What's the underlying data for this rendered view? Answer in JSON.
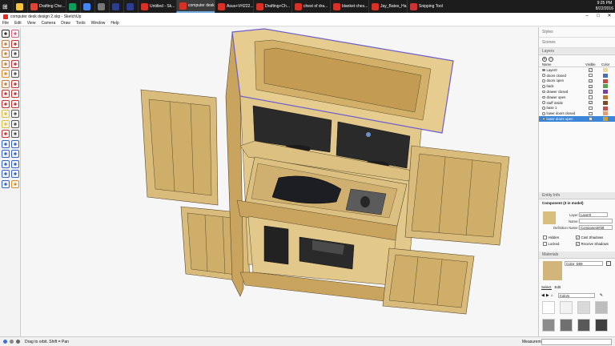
{
  "taskbar": {
    "items": [
      {
        "label": "",
        "icon": "folder-icon",
        "color": "#f4c542"
      },
      {
        "label": "Drafting Che...",
        "icon": "chrome-icon",
        "color": "#db4437"
      },
      {
        "label": "",
        "icon": "chrome-icon",
        "color": "#0f9d58"
      },
      {
        "label": "",
        "icon": "chrome-icon",
        "color": "#4285f4"
      },
      {
        "label": "",
        "icon": "calculator-icon",
        "color": "#777777"
      },
      {
        "label": "",
        "icon": "photoshop-icon",
        "color": "#2d3e8f"
      },
      {
        "label": "",
        "icon": "photoshop-icon",
        "color": "#2d3e8f"
      },
      {
        "label": "Untitled - Sk...",
        "icon": "sketchup-icon",
        "color": "#d93025"
      },
      {
        "label": "computer desk...",
        "icon": "sketchup-icon",
        "color": "#d93025",
        "active": true
      },
      {
        "label": "Asus+VH222...",
        "icon": "sketchup-icon",
        "color": "#d93025"
      },
      {
        "label": "Drafting+Ch...",
        "icon": "sketchup-icon",
        "color": "#d93025"
      },
      {
        "label": "chest of dra...",
        "icon": "sketchup-icon",
        "color": "#d93025"
      },
      {
        "label": "blanket ches...",
        "icon": "sketchup-icon",
        "color": "#d93025"
      },
      {
        "label": "Jay_Bates_Ha...",
        "icon": "sketchup-icon",
        "color": "#d93025"
      },
      {
        "label": "Snipping Tool",
        "icon": "scissors-icon",
        "color": "#cc3333"
      }
    ],
    "time": "9:25 PM",
    "date": "8/22/2016"
  },
  "window": {
    "title": "computer desk design 2.skp - SketchUp"
  },
  "menu": [
    "File",
    "Edit",
    "View",
    "Camera",
    "Draw",
    "Tools",
    "Window",
    "Help"
  ],
  "tools": [
    {
      "icon": "select-arrow-icon",
      "color": "#333333"
    },
    {
      "icon": "eraser-icon",
      "color": "#e06080"
    },
    {
      "icon": "rectangle-icon",
      "color": "#c08040"
    },
    {
      "icon": "pencil-icon",
      "color": "#cc3333"
    },
    {
      "icon": "rectangle-tool-icon",
      "color": "#c08040"
    },
    {
      "icon": "line-icon",
      "color": "#555555"
    },
    {
      "icon": "circle-icon",
      "color": "#c08040"
    },
    {
      "icon": "arc-icon",
      "color": "#cc3333"
    },
    {
      "icon": "polygon-icon",
      "color": "#e09020"
    },
    {
      "icon": "freehand-icon",
      "color": "#555555"
    },
    {
      "icon": "push-pull-icon",
      "color": "#c08040"
    },
    {
      "icon": "move-icon",
      "color": "#cc3333"
    },
    {
      "icon": "rotate-icon",
      "color": "#cc3333"
    },
    {
      "icon": "follow-me-icon",
      "color": "#cc3333"
    },
    {
      "icon": "scale-icon",
      "color": "#cc3333"
    },
    {
      "icon": "offset-icon",
      "color": "#cc3333"
    },
    {
      "icon": "tape-measure-icon",
      "color": "#e0c030"
    },
    {
      "icon": "dimension-icon",
      "color": "#555555"
    },
    {
      "icon": "protractor-icon",
      "color": "#e0c030"
    },
    {
      "icon": "text-icon",
      "color": "#555555"
    },
    {
      "icon": "axes-icon",
      "color": "#cc3333"
    },
    {
      "icon": "3d-text-icon",
      "color": "#555555"
    },
    {
      "icon": "orbit-icon",
      "color": "#3366cc"
    },
    {
      "icon": "pan-icon",
      "color": "#3366cc"
    },
    {
      "icon": "zoom-icon",
      "color": "#3366cc"
    },
    {
      "icon": "zoom-window-icon",
      "color": "#3366cc"
    },
    {
      "icon": "zoom-extents-icon",
      "color": "#3366cc"
    },
    {
      "icon": "previous-view-icon",
      "color": "#3366cc"
    },
    {
      "icon": "position-camera-icon",
      "color": "#3366cc"
    },
    {
      "icon": "walk-icon",
      "color": "#3366cc"
    },
    {
      "icon": "look-around-icon",
      "color": "#3366cc"
    },
    {
      "icon": "section-plane-icon",
      "color": "#e09020"
    }
  ],
  "status": {
    "hint": "Drag to orbit.  Shift = Pan",
    "measure_label": "Measurements"
  },
  "tray": {
    "styles_label": "Styles",
    "scenes_label": "Scenes",
    "layers": {
      "title": "Layers",
      "col_name": "Name",
      "col_visible": "Visible",
      "col_color": "Color",
      "rows": [
        {
          "name": "Layer0",
          "visible": true,
          "color": "#e8d9a0"
        },
        {
          "name": "doors closed",
          "visible": false,
          "color": "#4b6fb5"
        },
        {
          "name": "doors open",
          "visible": true,
          "color": "#c44a4a"
        },
        {
          "name": "back",
          "visible": true,
          "color": "#5aa04d"
        },
        {
          "name": "drawer closed",
          "visible": true,
          "color": "#7b3fa0"
        },
        {
          "name": "drawer open",
          "visible": false,
          "color": "#c07a30"
        },
        {
          "name": "stuff inside",
          "visible": true,
          "color": "#7a4a24"
        },
        {
          "name": "base 1",
          "visible": false,
          "color": "#c05050"
        },
        {
          "name": "lower doors closed",
          "visible": false,
          "color": "#e0a070"
        },
        {
          "name": "lower doors open",
          "visible": true,
          "color": "#c8a040",
          "selected": true
        }
      ]
    },
    "entity_info": {
      "title": "Entity Info",
      "component": "Component (3 in model)",
      "layer_label": "Layer:",
      "layer_value": "Layer0",
      "name_label": "Name:",
      "name_value": "",
      "definition_label": "Definition Name:",
      "definition_value": "Component#28",
      "hidden_label": "Hidden",
      "locked_label": "Locked",
      "cast_label": "Cast Shadows",
      "receive_label": "Receive Shadows",
      "swatch_color": "#d8bf80"
    },
    "materials": {
      "title": "Materials",
      "material_name": "Color_D09",
      "swatch_color": "#d2b57a",
      "select_tab": "Select",
      "edit_tab": "Edit",
      "library": "Colors",
      "palette": [
        "#ffffff",
        "#f2f2f2",
        "#d9d9d9",
        "#bdbdbd",
        "#8c8c8c",
        "#707070",
        "#595959",
        "#404040",
        "#f0b0b0",
        "#e03030",
        "#f04040",
        "#ff2a2a"
      ]
    }
  }
}
